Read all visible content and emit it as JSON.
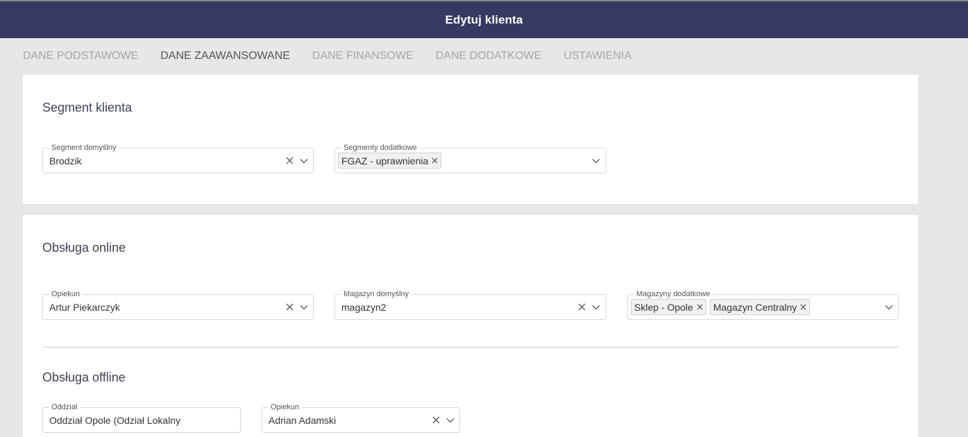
{
  "header": {
    "title": "Edytuj klienta"
  },
  "tabs": [
    {
      "label": "DANE PODSTAWOWE"
    },
    {
      "label": "DANE ZAAWANSOWANE"
    },
    {
      "label": "DANE FINANSOWE"
    },
    {
      "label": "DANE DODATKOWE"
    },
    {
      "label": "USTAWIENIA"
    }
  ],
  "segment": {
    "title": "Segment klienta",
    "default": {
      "label": "Segment domyślny",
      "value": "Brodzik"
    },
    "additional": {
      "label": "Segmenty dodatkowe",
      "chips": [
        "FGAZ - uprawnienia"
      ]
    }
  },
  "online": {
    "title": "Obsługa online",
    "guardian": {
      "label": "Opiekun",
      "value": "Artur Piekarczyk"
    },
    "warehouse": {
      "label": "Magazyn domyślny",
      "value": "magazyn2"
    },
    "warehouses_extra": {
      "label": "Magazyny dodatkowe",
      "chips": [
        "Sklep - Opole",
        "Magazyn Centralny"
      ]
    }
  },
  "offline": {
    "title": "Obsługa offline",
    "branch": {
      "label": "Oddział",
      "value": "Oddział Opole (Odział Lokalny"
    },
    "guardian": {
      "label": "Opiekun",
      "value": "Adrian Adamski"
    }
  },
  "colors": {
    "header_bg": "#363961",
    "page_bg": "#e7e7e7",
    "active_tab": "#555555",
    "inactive_tab": "#a6a6a6"
  },
  "icons": {
    "clear": "close-icon",
    "dropdown": "chevron-down-icon"
  }
}
